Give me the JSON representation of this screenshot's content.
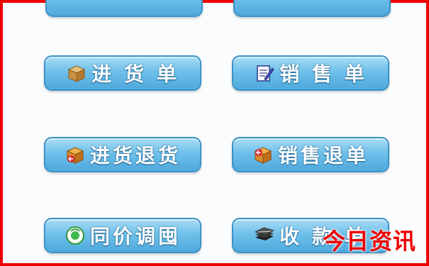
{
  "buttons": {
    "purchase_order": {
      "label": "进 货 单",
      "icon": "cardboard-box-icon"
    },
    "sales_order": {
      "label": "销 售 单",
      "icon": "notepad-pencil-icon"
    },
    "purchase_return": {
      "label": "进货退货",
      "icon": "box-return-icon"
    },
    "sales_return": {
      "label": "销售退单",
      "icon": "box-return-icon"
    },
    "price_adjust": {
      "label": "同价调囤",
      "icon": "green-cycle-icon"
    },
    "receipt": {
      "label": "收 款 单",
      "icon": "cash-stack-icon"
    }
  },
  "watermark": "今日资讯",
  "colors": {
    "border": "#ee0000",
    "button_top": "#a9dcf5",
    "button_bottom": "#4ea9dc",
    "watermark": "#ee0000"
  }
}
